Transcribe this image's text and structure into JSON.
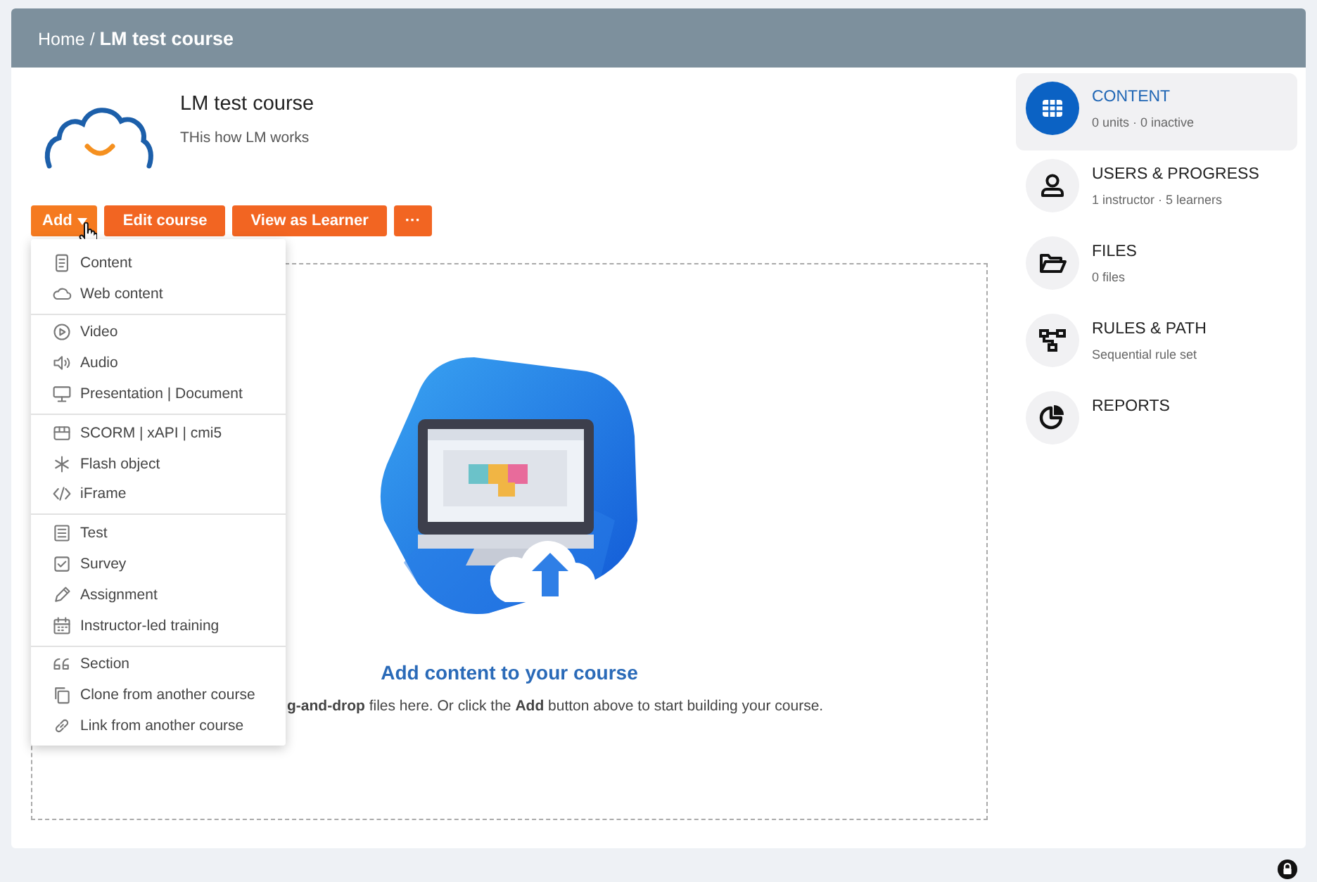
{
  "header": {
    "breadcrumb": "Home / **LM test course**"
  },
  "course": {
    "title": "LM test course",
    "description": "THis how LM works"
  },
  "buttons": [
    {
      "label": "Add",
      "kind": "dropdown"
    },
    {
      "label": "Edit course",
      "kind": "plain"
    },
    {
      "label": "View as Learner",
      "kind": "plain"
    },
    {
      "label": "···",
      "kind": "more"
    }
  ],
  "add_menu": {
    "groups": [
      [
        {
          "label": "Content"
        },
        {
          "label": "Web content"
        }
      ],
      [
        {
          "label": "Video"
        },
        {
          "label": "Audio"
        },
        {
          "label": "Presentation | Document"
        }
      ],
      [
        {
          "label": "SCORM | xAPI | cmi5"
        },
        {
          "label": "Flash object"
        },
        {
          "label": "iFrame"
        }
      ],
      [
        {
          "label": "Test"
        },
        {
          "label": "Survey"
        },
        {
          "label": "Assignment"
        },
        {
          "label": "Instructor-led training"
        }
      ],
      [
        {
          "label": "Section"
        },
        {
          "label": "Clone from another course"
        },
        {
          "label": "Link from another course"
        }
      ]
    ]
  },
  "empty_state": {
    "title": "Add content to your course",
    "text": "**g-and-drop** files here. Or click the **Add** button above to start building your course."
  },
  "sidebar": {
    "items": [
      {
        "title": "CONTENT",
        "subtitle": "0 units · 0 inactive",
        "selected": true
      },
      {
        "title": "USERS & PROGRESS",
        "subtitle": "1 instructor · 5 learners",
        "selected": false
      },
      {
        "title": "FILES",
        "subtitle": "0 files",
        "selected": false
      },
      {
        "title": "RULES & PATH",
        "subtitle": "Sequential rule set",
        "selected": false
      },
      {
        "title": "REPORTS",
        "selected": false
      }
    ]
  }
}
